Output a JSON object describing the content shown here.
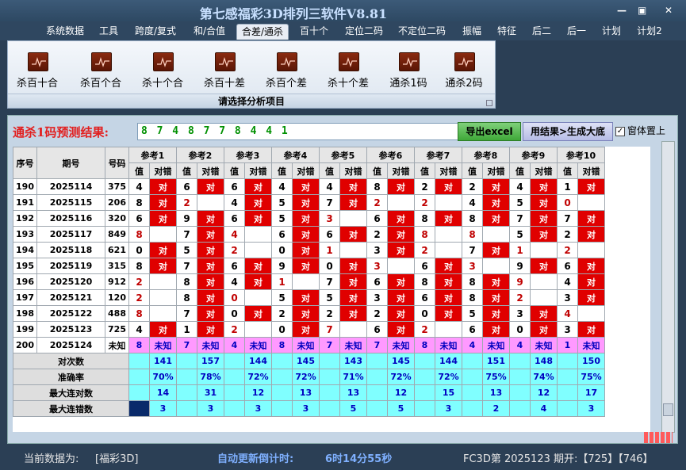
{
  "app": {
    "title": "第七感福彩3D排列三软件V8.81"
  },
  "window_buttons": {
    "minimize": "—",
    "restore": "▣",
    "close": "✕"
  },
  "menu": [
    "系统数据",
    "工具",
    "跨度/复式",
    "和/合值",
    "合差/通杀",
    "百十个",
    "定位二码",
    "不定位二码",
    "振幅",
    "特征",
    "后二",
    "后一",
    "计划",
    "计划2"
  ],
  "ribbon": {
    "items": [
      "杀百十合",
      "杀百个合",
      "杀十个合",
      "杀百十差",
      "杀百个差",
      "杀十个差",
      "通杀1码",
      "通杀2码"
    ],
    "caption": "请选择分析项目"
  },
  "result": {
    "label": "通杀1码预测结果:",
    "value": "8 7 4 8 7 7 8 4 4 1",
    "export_btn": "导出excel",
    "generate_btn": "用结果>生成大底",
    "topmost_label": "窗体置上",
    "topmost_checked": "✓"
  },
  "table": {
    "headers": {
      "seq": "序号",
      "period": "期号",
      "number": "号码",
      "refs": [
        "参考1",
        "参考2",
        "参考3",
        "参考4",
        "参考5",
        "参考6",
        "参考7",
        "参考8",
        "参考9",
        "参考10"
      ],
      "val": "值",
      "judge": "对错"
    },
    "hit_text": "对",
    "unknown_text": "未知",
    "rows": [
      {
        "seq": "190",
        "period": "2025114",
        "number": "375",
        "vals": [
          "4",
          "6",
          "6",
          "4",
          "4",
          "8",
          "2",
          "2",
          "4",
          "1"
        ],
        "res": [
          1,
          1,
          1,
          1,
          1,
          1,
          1,
          1,
          1,
          1
        ]
      },
      {
        "seq": "191",
        "period": "2025115",
        "number": "206",
        "vals": [
          "8",
          "2",
          "4",
          "5",
          "7",
          "2",
          "2",
          "4",
          "5",
          "0"
        ],
        "res": [
          1,
          0,
          1,
          1,
          1,
          0,
          0,
          1,
          1,
          0
        ]
      },
      {
        "seq": "192",
        "period": "2025116",
        "number": "320",
        "vals": [
          "6",
          "9",
          "6",
          "5",
          "3",
          "6",
          "8",
          "8",
          "7",
          "7"
        ],
        "res": [
          1,
          1,
          1,
          1,
          0,
          1,
          1,
          1,
          1,
          1
        ]
      },
      {
        "seq": "193",
        "period": "2025117",
        "number": "849",
        "vals": [
          "8",
          "7",
          "4",
          "6",
          "6",
          "2",
          "8",
          "8",
          "5",
          "2"
        ],
        "res": [
          0,
          1,
          0,
          1,
          1,
          1,
          0,
          0,
          1,
          1
        ]
      },
      {
        "seq": "194",
        "period": "2025118",
        "number": "621",
        "vals": [
          "0",
          "5",
          "2",
          "0",
          "1",
          "3",
          "2",
          "7",
          "1",
          "2"
        ],
        "res": [
          1,
          1,
          0,
          1,
          0,
          1,
          0,
          1,
          0,
          0
        ]
      },
      {
        "seq": "195",
        "period": "2025119",
        "number": "315",
        "vals": [
          "8",
          "7",
          "6",
          "9",
          "0",
          "3",
          "6",
          "3",
          "9",
          "6"
        ],
        "res": [
          1,
          1,
          1,
          1,
          1,
          0,
          1,
          0,
          1,
          1
        ]
      },
      {
        "seq": "196",
        "period": "2025120",
        "number": "912",
        "vals": [
          "2",
          "8",
          "4",
          "1",
          "7",
          "6",
          "8",
          "8",
          "9",
          "4"
        ],
        "res": [
          0,
          1,
          1,
          0,
          1,
          1,
          1,
          1,
          0,
          1
        ]
      },
      {
        "seq": "197",
        "period": "2025121",
        "number": "120",
        "vals": [
          "2",
          "8",
          "0",
          "5",
          "5",
          "3",
          "6",
          "8",
          "2",
          "3"
        ],
        "res": [
          0,
          1,
          0,
          1,
          1,
          1,
          1,
          1,
          0,
          1
        ]
      },
      {
        "seq": "198",
        "period": "2025122",
        "number": "488",
        "vals": [
          "8",
          "7",
          "0",
          "2",
          "2",
          "2",
          "0",
          "5",
          "3",
          "4"
        ],
        "res": [
          0,
          1,
          1,
          1,
          1,
          1,
          1,
          1,
          1,
          0
        ]
      },
      {
        "seq": "199",
        "period": "2025123",
        "number": "725",
        "vals": [
          "4",
          "1",
          "2",
          "0",
          "7",
          "6",
          "2",
          "6",
          "0",
          "3"
        ],
        "res": [
          1,
          1,
          0,
          1,
          0,
          1,
          0,
          1,
          1,
          1
        ]
      }
    ],
    "pending": {
      "seq": "200",
      "period": "2025124",
      "number": "未知",
      "vals": [
        "8",
        "7",
        "4",
        "8",
        "7",
        "7",
        "8",
        "4",
        "4",
        "1"
      ]
    },
    "stats": [
      {
        "label": "对次数",
        "vals": [
          "141",
          "157",
          "144",
          "145",
          "143",
          "145",
          "144",
          "151",
          "148",
          "150"
        ]
      },
      {
        "label": "准确率",
        "vals": [
          "70%",
          "78%",
          "72%",
          "72%",
          "71%",
          "72%",
          "72%",
          "75%",
          "74%",
          "75%"
        ]
      },
      {
        "label": "最大连对数",
        "vals": [
          "14",
          "31",
          "12",
          "13",
          "13",
          "12",
          "15",
          "13",
          "12",
          "17"
        ]
      },
      {
        "label": "最大连错数",
        "vals": [
          "3",
          "3",
          "3",
          "3",
          "5",
          "5",
          "3",
          "2",
          "4",
          "3"
        ]
      }
    ]
  },
  "status": {
    "current_label": "当前数据为:",
    "current_value": "[福彩3D]",
    "countdown_label": "自动更新倒计时:",
    "countdown_value": "6时14分55秒",
    "issue_text": "FC3D第 2025123 期开:【725】【746】"
  },
  "colors": {
    "hit": "#e00000",
    "unknown_row": "#ff99ff",
    "stats_bg": "#80ffff",
    "result_label": "#e21f1f",
    "result_value": "#009000"
  }
}
